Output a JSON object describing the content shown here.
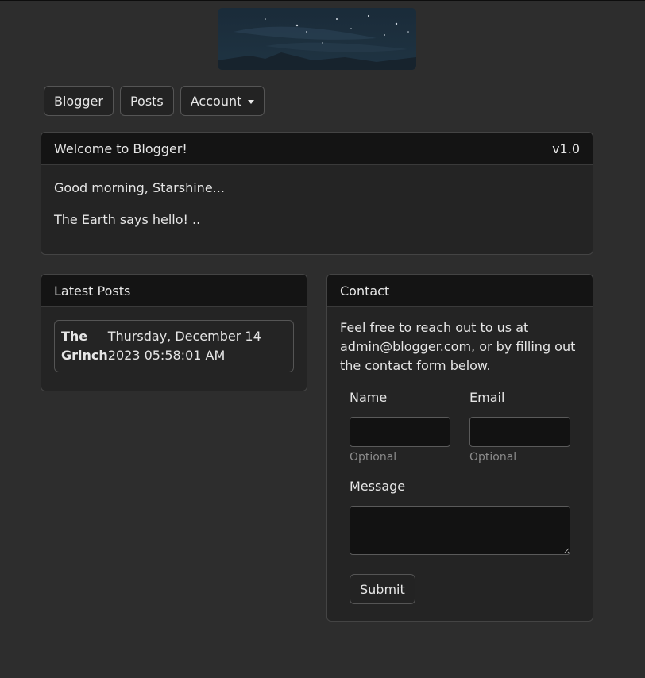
{
  "nav": {
    "blogger_label": "Blogger",
    "posts_label": "Posts",
    "account_label": "Account"
  },
  "welcome": {
    "title": "Welcome to Blogger!",
    "version": "v1.0",
    "greeting": "Good morning, Starshine...",
    "message": "The Earth says hello! .."
  },
  "latest_posts": {
    "title": "Latest Posts",
    "items": [
      {
        "title": "The Grinch",
        "date": "Thursday, December 14 2023 05:58:01 AM"
      }
    ]
  },
  "contact": {
    "title": "Contact",
    "intro": "Feel free to reach out to us at admin@blogger.com, or by filling out the contact form below.",
    "name_label": "Name",
    "name_value": "",
    "name_hint": "Optional",
    "email_label": "Email",
    "email_value": "",
    "email_hint": "Optional",
    "message_label": "Message",
    "message_value": "",
    "submit_label": "Submit"
  },
  "colors": {
    "page_background": "#2d2d2d",
    "card_background": "#242424",
    "card_header": "#141414",
    "input_background": "#121212",
    "hint_text": "#8a8a8a"
  }
}
